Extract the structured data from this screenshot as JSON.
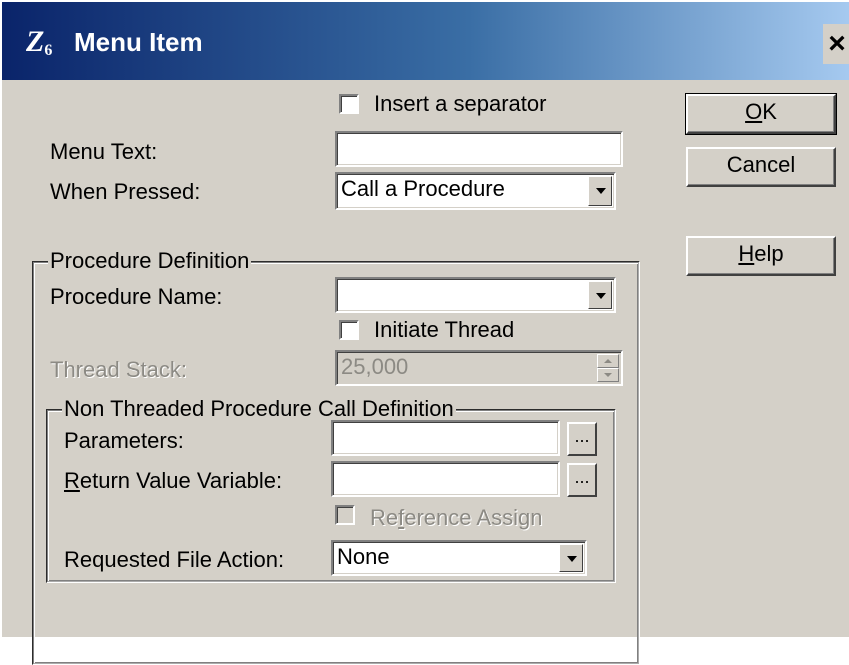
{
  "window": {
    "title": "Menu Item",
    "icon": "clarion-app-icon",
    "icon_glyph": "Z",
    "icon_sub": "6",
    "close_glyph": "×"
  },
  "form": {
    "insert_separator_label": "Insert a separator",
    "insert_separator_checked": false,
    "menu_text_label": "Menu Text:",
    "menu_text_value": "",
    "when_pressed_label": "When Pressed:",
    "when_pressed_value": "Call a Procedure"
  },
  "procedure_group": {
    "title": "Procedure Definition",
    "procedure_name_label": "Procedure Name:",
    "procedure_name_value": "",
    "initiate_thread_label": "Initiate Thread",
    "initiate_thread_checked": false,
    "thread_stack_label": "Thread Stack:",
    "thread_stack_value": "25,000"
  },
  "call_group": {
    "title": "Non Threaded Procedure Call Definition",
    "parameters_label": "Parameters:",
    "parameters_value": "",
    "return_value_label_prefix": "",
    "return_value_label_mnemonic": "R",
    "return_value_label_rest": "eturn Value Variable:",
    "return_value_value": "",
    "ellipsis": "...",
    "reference_assign_prefix": "Re",
    "reference_assign_mnemonic": "f",
    "reference_assign_rest": "erence Assign",
    "requested_file_action_label": "Requested File Action:",
    "requested_file_action_value": "None"
  },
  "buttons": {
    "ok_mnemonic": "O",
    "ok_rest": "K",
    "cancel": "Cancel",
    "help_mnemonic": "H",
    "help_rest": "elp"
  },
  "colors": {
    "title_gradient_start": "#0a246a",
    "title_gradient_end": "#a6caf0",
    "dialog_bg": "#d4d0c8",
    "disabled_text": "#8c8a84"
  }
}
